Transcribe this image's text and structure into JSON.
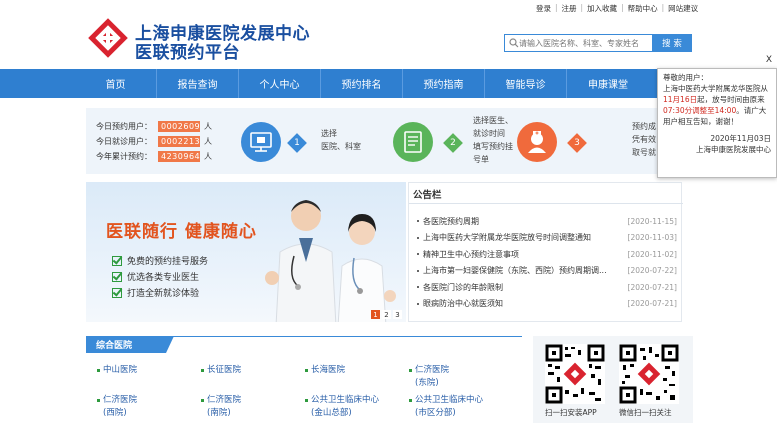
{
  "toplinks": [
    "登录",
    "注册",
    "加入收藏",
    "帮助中心",
    "网站建议"
  ],
  "logo": {
    "line1": "上海申康医院发展中心",
    "line2": "医联预约平台"
  },
  "search": {
    "placeholder": "请输入医院名称、科室、专家姓名",
    "button": "搜 索"
  },
  "nav": [
    "首页",
    "报告查询",
    "个人中心",
    "预约排名",
    "预约指南",
    "智能导诊",
    "申康课堂"
  ],
  "stats": [
    {
      "label": "今日预约用户：",
      "value": "0002609",
      "unit": "人"
    },
    {
      "label": "今日就诊用户：",
      "value": "0002213",
      "unit": "人"
    },
    {
      "label": "今年累计预约：",
      "value": "4230964",
      "unit": "人"
    }
  ],
  "steps": [
    {
      "num": "1",
      "lines": [
        "选择",
        "医院、科室"
      ]
    },
    {
      "num": "2",
      "lines": [
        "选择医生、",
        "就诊时间",
        "填写预约挂",
        "号单"
      ]
    },
    {
      "num": "3",
      "lines": [
        "预约成",
        "凭有效",
        "取号就"
      ]
    }
  ],
  "banner": {
    "headline": "医联随行  健康随心",
    "features": [
      "免费的预约挂号服务",
      "优选各类专业医生",
      "打造全新就诊体验"
    ],
    "pages": [
      "1",
      "2",
      "3"
    ]
  },
  "notice": {
    "title": "公告栏",
    "items": [
      {
        "text": "各医院预约周期",
        "date": "[2020-11-15]"
      },
      {
        "text": "上海中医药大学附属龙华医院放号时间调整通知",
        "date": "[2020-11-03]"
      },
      {
        "text": "精神卫生中心预约注意事项",
        "date": "[2020-11-02]"
      },
      {
        "text": "上海市第一妇婴保健院（东院、西院）预约周期调...",
        "date": "[2020-07-22]"
      },
      {
        "text": "各医院门诊的年龄限制",
        "date": "[2020-07-21]"
      },
      {
        "text": "眼病防治中心就医须知",
        "date": "[2020-07-21]"
      }
    ]
  },
  "hospitals": {
    "tab": "综合医院",
    "cells": [
      {
        "line1": "中山医院",
        "line2": ""
      },
      {
        "line1": "长征医院",
        "line2": ""
      },
      {
        "line1": "长海医院",
        "line2": ""
      },
      {
        "line1": "仁济医院",
        "line2": "(东院)"
      },
      {
        "line1": "仁济医院",
        "line2": "(西院)"
      },
      {
        "line1": "仁济医院",
        "line2": "(南院)"
      },
      {
        "line1": "公共卫生临床中心",
        "line2": "(金山总部)"
      },
      {
        "line1": "公共卫生临床中心",
        "line2": "(市区分部)"
      }
    ]
  },
  "qr": {
    "app_caption": "扫一扫安装APP",
    "wechat_caption": "微信扫一扫关注"
  },
  "popup": {
    "close": "X",
    "greeting": "尊敬的用户：",
    "body1": "上海中医药大学附属龙华医院从",
    "date_red": "11月16日",
    "body2": "起，放号时间由原来",
    "time_red": "07:30分调整至14:00",
    "body3": "。请广大用户相互告知，谢谢！",
    "sign_date": "2020年11月03日",
    "sign_org": "上海申康医院发展中心"
  },
  "colors": {
    "nav": "#2f7fd0",
    "accent": "#e2541f",
    "step1": "#3a8ad8",
    "step2": "#5ab45a",
    "step3": "#f06a3c"
  }
}
